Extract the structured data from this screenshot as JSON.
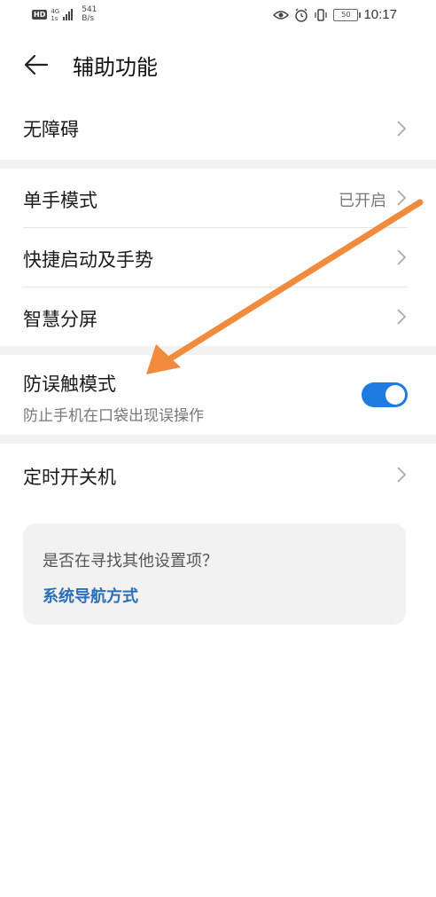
{
  "status_bar": {
    "hd": "HD",
    "network": "4G",
    "network_sub": "1s",
    "speed_value": "541",
    "speed_unit": "B/s",
    "battery": "50",
    "time": "10:17"
  },
  "header": {
    "title": "辅助功能"
  },
  "items": [
    {
      "label": "无障碍"
    },
    {
      "label": "单手模式",
      "status": "已开启"
    },
    {
      "label": "快捷启动及手势"
    },
    {
      "label": "智慧分屏"
    },
    {
      "label": "防误触模式",
      "description": "防止手机在口袋出现误操作",
      "toggle_on": true
    },
    {
      "label": "定时开关机"
    }
  ],
  "suggest_card": {
    "question": "是否在寻找其他设置项？",
    "link": "系统导航方式"
  },
  "colors": {
    "accent": "#1e7be0",
    "link": "#2a6fb8",
    "annotation_arrow": "#f08a3c"
  }
}
